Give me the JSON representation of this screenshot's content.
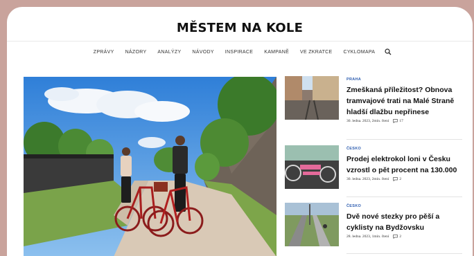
{
  "site": {
    "logo": "MĚSTEM NA KOLE"
  },
  "nav": {
    "items": [
      "ZPRÁVY",
      "NÁZORY",
      "ANALÝZY",
      "NÁVODY",
      "INSPIRACE",
      "KAMPANĚ",
      "VE ZKRATCE",
      "CYKLOMAPA"
    ],
    "search_icon": "search-icon"
  },
  "articles": [
    {
      "kicker": "PRAHA",
      "title": "Zmeškaná příležitost? Obnova tramvajové trati na Malé Straně hladší dlažbu nepřinese",
      "date": "30. ledna. 2023, 2min. čtení",
      "comments": "17"
    },
    {
      "kicker": "ČESKO",
      "title": "Prodej elektrokol loni v Česku vzrostl o pět procent na 130.000",
      "date": "30. ledna. 2023, 2min. čtení",
      "comments": "2"
    },
    {
      "kicker": "ČESKO",
      "title": "Dvě nové stezky pro pěší a cyklisty na Bydžovsku",
      "date": "28. ledna. 2023, 1min. čtení",
      "comments": "2"
    }
  ],
  "colors": {
    "background": "#c9a39c",
    "kicker": "#2d5db0"
  }
}
